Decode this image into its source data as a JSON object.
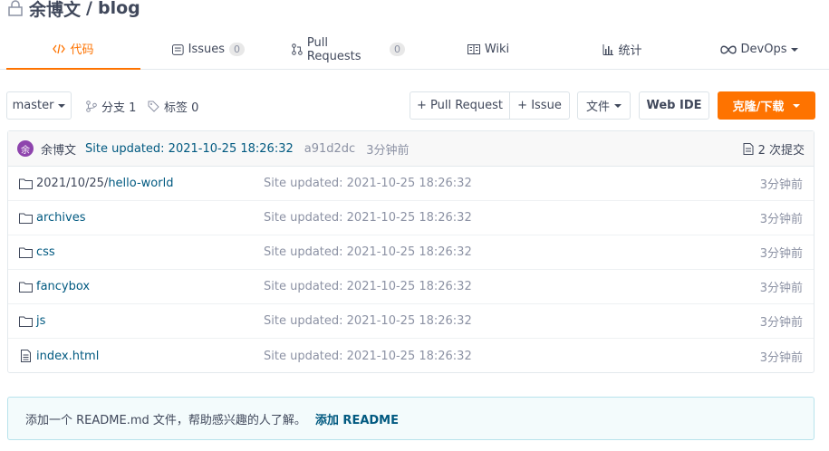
{
  "repo": {
    "owner": "余博文",
    "separator": "/",
    "name": "blog"
  },
  "tabs": [
    {
      "label": "代码",
      "icon": "code-icon",
      "active": true
    },
    {
      "label": "Issues",
      "count": "0",
      "icon": "issues-icon"
    },
    {
      "label": "Pull Requests",
      "count": "0",
      "icon": "pull-request-icon"
    },
    {
      "label": "Wiki",
      "icon": "wiki-icon"
    },
    {
      "label": "统计",
      "icon": "stats-icon"
    },
    {
      "label": "DevOps",
      "icon": "devops-icon"
    }
  ],
  "toolbar": {
    "branch": "master",
    "branches_label": "分支 1",
    "tags_label": "标签 0",
    "pull_request_label": "+ Pull Request",
    "issue_label": "+ Issue",
    "file_label": "文件",
    "web_ide_label": "Web IDE",
    "clone_label": "克隆/下载"
  },
  "commit": {
    "avatar_text": "余",
    "author": "余博文",
    "message": "Site updated: 2021-10-25 18:26:32",
    "sha": "a91d2dc",
    "ago": "3分钟前",
    "commit_count_label": "2 次提交"
  },
  "files": [
    {
      "type": "folder",
      "dir": "2021/10/25/",
      "name": "hello-world",
      "message": "Site updated: 2021-10-25 18:26:32",
      "time": "3分钟前"
    },
    {
      "type": "folder",
      "dir": "",
      "name": "archives",
      "message": "Site updated: 2021-10-25 18:26:32",
      "time": "3分钟前"
    },
    {
      "type": "folder",
      "dir": "",
      "name": "css",
      "message": "Site updated: 2021-10-25 18:26:32",
      "time": "3分钟前"
    },
    {
      "type": "folder",
      "dir": "",
      "name": "fancybox",
      "message": "Site updated: 2021-10-25 18:26:32",
      "time": "3分钟前"
    },
    {
      "type": "folder",
      "dir": "",
      "name": "js",
      "message": "Site updated: 2021-10-25 18:26:32",
      "time": "3分钟前"
    },
    {
      "type": "file",
      "dir": "",
      "name": "index.html",
      "message": "Site updated: 2021-10-25 18:26:32",
      "time": "3分钟前"
    }
  ],
  "readme": {
    "text": "添加一个 README.md 文件，帮助感兴趣的人了解。",
    "link": "添加 README"
  },
  "colors": {
    "accent": "#fe7300",
    "link": "#005980"
  }
}
